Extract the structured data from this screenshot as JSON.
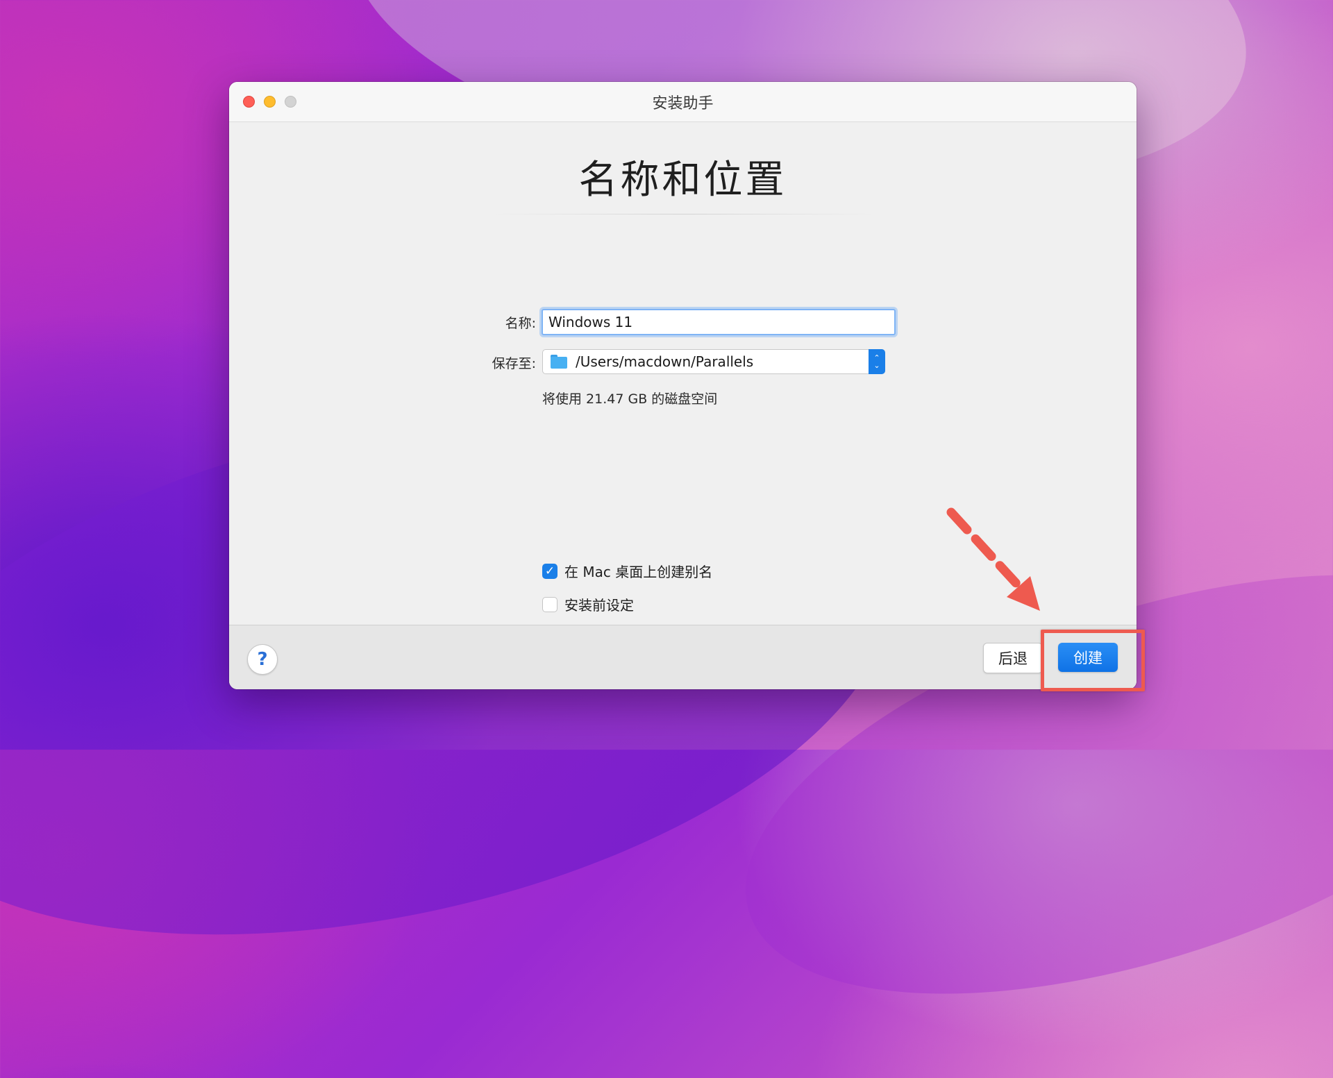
{
  "window": {
    "title": "安装助手"
  },
  "page": {
    "heading": "名称和位置"
  },
  "form": {
    "name_label": "名称:",
    "name_value": "Windows 11",
    "save_label": "保存至:",
    "save_path": "/Users/macdown/Parallels",
    "disk_info": "将使用 21.47 GB 的磁盘空间"
  },
  "options": {
    "desktop_alias": {
      "label": "在 Mac 桌面上创建别名",
      "checked": true
    },
    "pre_install": {
      "label": "安装前设定",
      "checked": false
    }
  },
  "footer": {
    "help_label": "?",
    "back_label": "后退",
    "create_label": "创建"
  },
  "icons": {
    "folder": "folder-icon",
    "stepper": "up-down-chevron-icon",
    "checkmark": "checkmark-icon",
    "annotation_arrow": "arrow-icon"
  },
  "colors": {
    "accent": "#1a7fe8",
    "annotation": "#ee5a4f",
    "close": "#fe5f57",
    "minimize": "#febc2e"
  }
}
